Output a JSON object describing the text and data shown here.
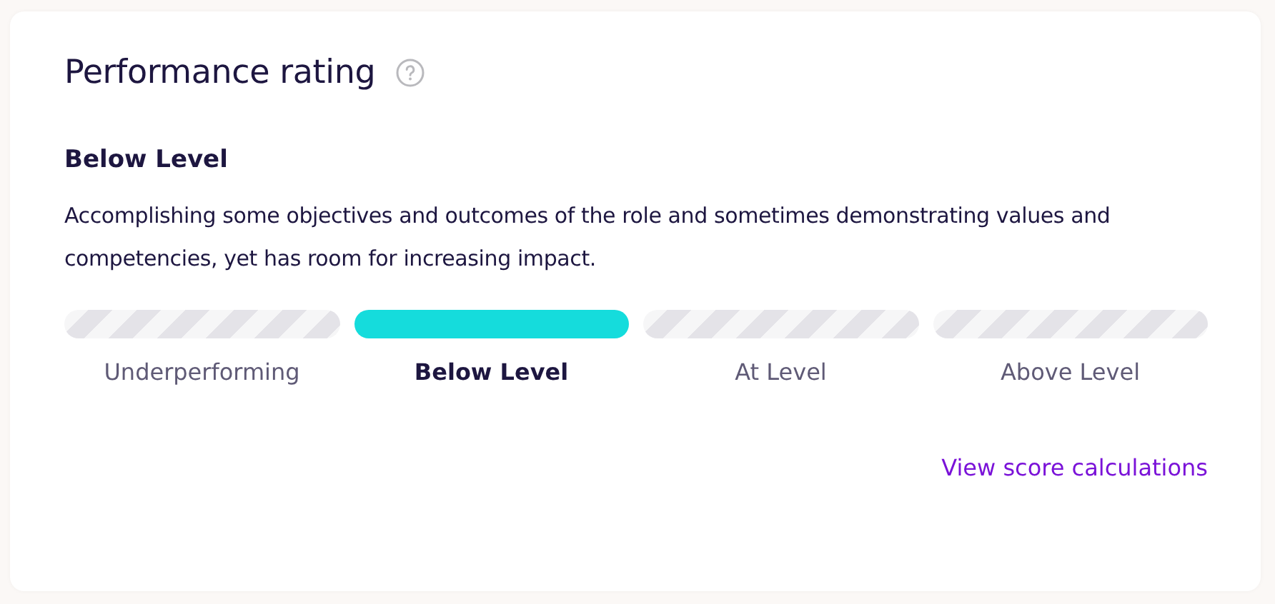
{
  "card": {
    "title": "Performance rating",
    "rating_title": "Below Level",
    "description": "Accomplishing some objectives and outcomes of the role and sometimes demonstrating values and competencies, yet has room for increasing impact.",
    "levels": [
      {
        "label": "Underperforming",
        "selected": false
      },
      {
        "label": "Below Level",
        "selected": true
      },
      {
        "label": "At Level",
        "selected": false
      },
      {
        "label": "Above Level",
        "selected": false
      }
    ],
    "link": "View score calculations"
  }
}
